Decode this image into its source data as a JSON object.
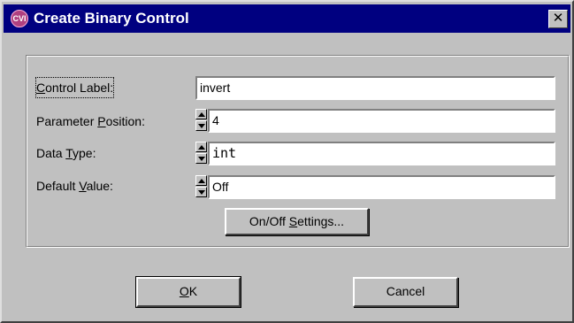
{
  "window": {
    "title": "Create Binary Control",
    "icon_name": "cvi-icon",
    "icon_text": "CVI",
    "close_glyph": "✕"
  },
  "form": {
    "control_label": {
      "label_prefix": "",
      "label_ul": "C",
      "label_suffix": "ontrol Label:",
      "value": "invert"
    },
    "parameter_position": {
      "label_prefix": "Parameter ",
      "label_ul": "P",
      "label_suffix": "osition:",
      "value": "4"
    },
    "data_type": {
      "label_prefix": "Data ",
      "label_ul": "T",
      "label_suffix": "ype:",
      "value": "int"
    },
    "default_value": {
      "label_prefix": "Default ",
      "label_ul": "V",
      "label_suffix": "alue:",
      "value": "Off"
    },
    "onoff_button": {
      "prefix": "On/Off ",
      "ul": "S",
      "suffix": "ettings..."
    }
  },
  "buttons": {
    "ok": {
      "ul": "O",
      "suffix": "K"
    },
    "cancel": {
      "label": "Cancel"
    }
  },
  "colors": {
    "title_bar": "#000080",
    "face": "#c0c0c0",
    "field": "#ffffff"
  }
}
